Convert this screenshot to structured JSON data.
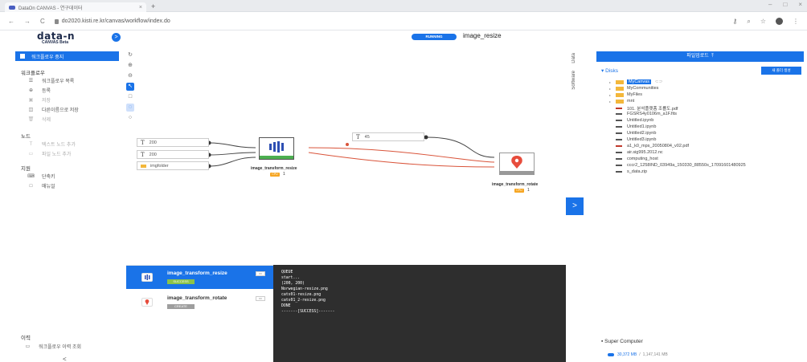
{
  "browser": {
    "tab_title": "DataOn CANVAS - 연구데이터",
    "tab_close": "×",
    "new_tab": "+",
    "url": "do2020.kisti.re.kr/canvas/workflow/index.do",
    "back": "←",
    "forward": "→",
    "reload": "C"
  },
  "app": {
    "logo": "data-n",
    "logo_sub": "CANVAS Beta",
    "header_toggle": ">",
    "status": "RUNNING",
    "workflow_name": "image_resize"
  },
  "sidebar": {
    "stop_label": "워크플로우 중지",
    "workflow_header": "워크플로우",
    "workflow_items": [
      {
        "icon": "list-icon",
        "glyph": "☰",
        "label": "워크플로우 목록",
        "enabled": true
      },
      {
        "icon": "plus-circle-icon",
        "glyph": "⊕",
        "label": "등록",
        "enabled": true
      },
      {
        "icon": "save-icon",
        "glyph": "▣",
        "label": "저장",
        "enabled": false
      },
      {
        "icon": "save-as-icon",
        "glyph": "◫",
        "label": "다른이름으로 저장",
        "enabled": true
      },
      {
        "icon": "trash-icon",
        "glyph": "🗑",
        "label": "삭제",
        "enabled": false
      }
    ],
    "node_header": "노드",
    "node_items": [
      {
        "icon": "text-node-icon",
        "glyph": "T",
        "label": "텍스트 노드 추가",
        "enabled": false
      },
      {
        "icon": "folder-node-icon",
        "glyph": "▭",
        "label": "파일 노드 추가",
        "enabled": false
      }
    ],
    "help_header": "지원",
    "help_items": [
      {
        "icon": "keyboard-icon",
        "glyph": "⌨",
        "label": "단축키",
        "enabled": true
      },
      {
        "icon": "book-icon",
        "glyph": "□",
        "label": "매뉴얼",
        "enabled": true
      }
    ],
    "history_header": "이력",
    "history_item": "워크플로우 이력 조회",
    "collapse": "<"
  },
  "canvas": {
    "side_tabs": [
      "Data",
      "Software"
    ],
    "inputs": [
      {
        "type": "T",
        "value": "200"
      },
      {
        "type": "T",
        "value": "200"
      },
      {
        "type": "folder",
        "value": "imgfolder"
      },
      {
        "type": "T",
        "value": "45"
      }
    ],
    "nodes": [
      {
        "name": "image_transform_resize",
        "status": "RUNNING",
        "badge": "CPU",
        "count": "1"
      },
      {
        "name": "image_transform_rotate",
        "status": "READY",
        "badge": "CPU",
        "count": "1"
      }
    ],
    "expand": ">"
  },
  "jobs": [
    {
      "name": "image_transform_resize",
      "status": "SUCCESS",
      "status_color": "#8bc34a",
      "selected": true
    },
    {
      "name": "image_transform_rotate",
      "status": "CREATE",
      "status_color": "#9e9e9e",
      "selected": false
    }
  ],
  "console_lines": [
    "QUEUE",
    "start...",
    "(200, 200)",
    "Norwegian-resize.png",
    "cats01-resize.png",
    "cats01_2-resize.png",
    "DONE",
    "-------[SUCCESS]-------"
  ],
  "files": {
    "upload_label": "파일업로드",
    "disks_label": "Disks",
    "new_folder_label": "새 폴더 생성",
    "tree": [
      {
        "kind": "dir",
        "name": "MyCanvas",
        "selected": true
      },
      {
        "kind": "dir",
        "name": "MyCommunities",
        "selected": false
      },
      {
        "kind": "dir",
        "name": "MyFiles",
        "selected": false
      },
      {
        "kind": "dir",
        "name": "mnt",
        "selected": false
      },
      {
        "kind": "pdf",
        "name": "101. 분석플랫폼 조률도.pdf"
      },
      {
        "kind": "file",
        "name": "FGSRS4y0106m_a1F.fits"
      },
      {
        "kind": "file",
        "name": "Untitled.ipynb"
      },
      {
        "kind": "file",
        "name": "Untitled1.ipynb"
      },
      {
        "kind": "file",
        "name": "Untitled2.ipynb"
      },
      {
        "kind": "file",
        "name": "Untitled3.ipynb"
      },
      {
        "kind": "pdf",
        "name": "a1_k0_mps_20050804_v02.pdf"
      },
      {
        "kind": "file",
        "name": "air.sig995.2012.nc"
      },
      {
        "kind": "file",
        "name": "computing_host"
      },
      {
        "kind": "file",
        "name": "cccr2_1258IND_03949a_150330_88550s_17091601480925"
      },
      {
        "kind": "file",
        "name": "s_data.zip"
      }
    ],
    "super_computer_label": "Super Computer",
    "usage_used": "30,372 MB",
    "usage_sep": "/",
    "usage_total": "1,147,141 MB"
  }
}
